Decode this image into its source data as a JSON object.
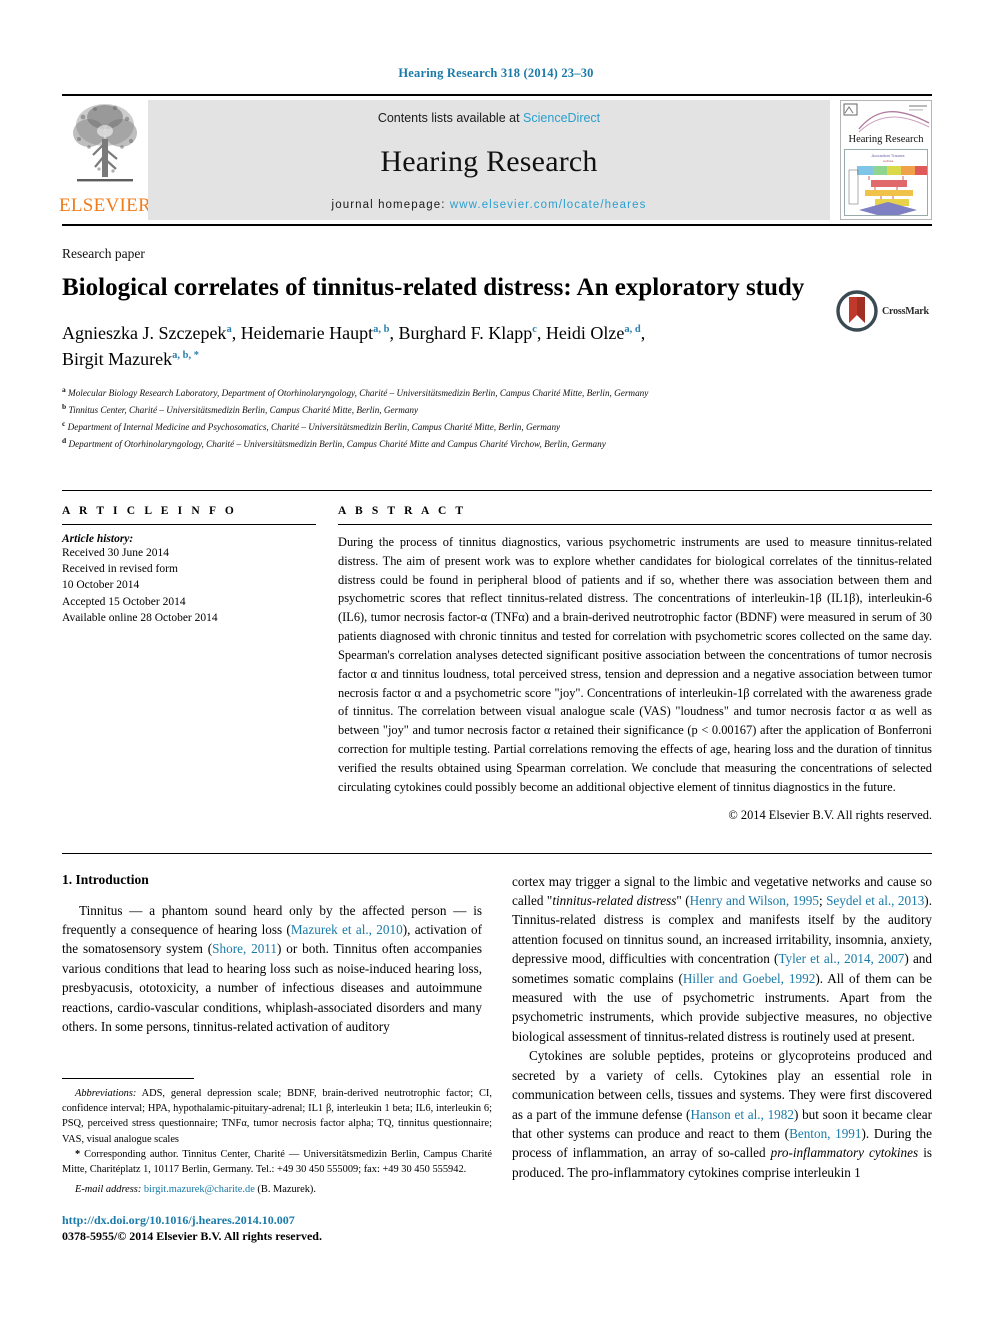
{
  "running_head": "Hearing Research 318 (2014) 23–30",
  "masthead": {
    "publisher_name": "ELSEVIER",
    "contents_prefix": "Contents lists available at",
    "contents_link": "ScienceDirect",
    "journal_title": "Hearing Research",
    "homepage_prefix": "journal homepage:",
    "homepage_link": "www.elsevier.com/locate/heares",
    "cover_title": "Hearing Research"
  },
  "article": {
    "doctype": "Research paper",
    "title": "Biological correlates of tinnitus-related distress: An exploratory study",
    "crossmark_label": "CrossMark",
    "authors_line1": "Agnieszka J. Szczepek",
    "authors": [
      {
        "name": "Agnieszka J. Szczepek",
        "marks": "a"
      },
      {
        "name": "Heidemarie Haupt",
        "marks": "a, b"
      },
      {
        "name": "Burghard F. Klapp",
        "marks": "c"
      },
      {
        "name": "Heidi Olze",
        "marks": "a, d"
      },
      {
        "name": "Birgit Mazurek",
        "marks": "a, b, *"
      }
    ],
    "affiliations": [
      {
        "mark": "a",
        "text": "Molecular Biology Research Laboratory, Department of Otorhinolaryngology, Charité – Universitätsmedizin Berlin, Campus Charité Mitte, Berlin, Germany"
      },
      {
        "mark": "b",
        "text": "Tinnitus Center, Charité – Universitätsmedizin Berlin, Campus Charité Mitte, Berlin, Germany"
      },
      {
        "mark": "c",
        "text": "Department of Internal Medicine and Psychosomatics, Charité – Universitätsmedizin Berlin, Campus Charité Mitte, Berlin, Germany"
      },
      {
        "mark": "d",
        "text": "Department of Otorhinolaryngology, Charité – Universitätsmedizin Berlin, Campus Charité Mitte and Campus Charité Virchow, Berlin, Germany"
      }
    ]
  },
  "article_info": {
    "heading": "A R T I C L E  I N F O",
    "history_label": "Article history:",
    "history": [
      "Received 30 June 2014",
      "Received in revised form",
      "10 October 2014",
      "Accepted 15 October 2014",
      "Available online 28 October 2014"
    ]
  },
  "abstract": {
    "heading": "A B S T R A C T",
    "text": "During the process of tinnitus diagnostics, various psychometric instruments are used to measure tinnitus-related distress. The aim of present work was to explore whether candidates for biological correlates of the tinnitus-related distress could be found in peripheral blood of patients and if so, whether there was association between them and psychometric scores that reflect tinnitus-related distress. The concentrations of interleukin-1β (IL1β), interleukin-6 (IL6), tumor necrosis factor-α (TNFα) and a brain-derived neutrotrophic factor (BDNF) were measured in serum of 30 patients diagnosed with chronic tinnitus and tested for correlation with psychometric scores collected on the same day. Spearman's correlation analyses detected significant positive association between the concentrations of tumor necrosis factor α and tinnitus loudness, total perceived stress, tension and depression and a negative association between tumor necrosis factor α and a psychometric score \"joy\". Concentrations of interleukin-1β correlated with the awareness grade of tinnitus. The correlation between visual analogue scale (VAS) \"loudness\" and tumor necrosis factor α as well as between \"joy\" and tumor necrosis factor α retained their significance (p < 0.00167) after the application of Bonferroni correction for multiple testing. Partial correlations removing the effects of age, hearing loss and the duration of tinnitus verified the results obtained using Spearman correlation. We conclude that measuring the concentrations of selected circulating cytokines could possibly become an additional objective element of tinnitus diagnostics in the future.",
    "copyright": "© 2014 Elsevier B.V. All rights reserved."
  },
  "introduction": {
    "heading": "1.  Introduction",
    "left_para_1_a": "Tinnitus — a phantom sound heard only by the affected person — is frequently a consequence of hearing loss (",
    "left_cite_1": "Mazurek et al., 2010",
    "left_para_1_b": "), activation of the somatosensory system (",
    "left_cite_2": "Shore, 2011",
    "left_para_1_c": ") or both. Tinnitus often accompanies various conditions that lead to hearing loss such as noise-induced hearing loss, presbyacusis, ototoxicity, a number of infectious diseases and autoimmune reactions, cardio-vascular conditions, whiplash-associated disorders and many others. In some persons, tinnitus-related activation of auditory",
    "right_para_1_a": "cortex may trigger a signal to the limbic and vegetative networks and cause so called \"",
    "right_italic_1": "tinnitus-related distress",
    "right_para_1_b": "\" (",
    "right_cite_1": "Henry and Wilson, 1995",
    "right_para_1_c": "; ",
    "right_cite_2": "Seydel et al., 2013",
    "right_para_1_d": "). Tinnitus-related distress is complex and manifests itself by the auditory attention focused on tinnitus sound, an increased irritability, insomnia, anxiety, depressive mood, difficulties with concentration (",
    "right_cite_3": "Tyler et al., 2014, 2007",
    "right_para_1_e": ") and sometimes somatic complains (",
    "right_cite_4": "Hiller and Goebel, 1992",
    "right_para_1_f": "). All of them can be measured with the use of psychometric instruments. Apart from the psychometric instruments, which provide subjective measures, no objective biological assessment of tinnitus-related distress is routinely used at present.",
    "right_para_2_a": "Cytokines are soluble peptides, proteins or glycoproteins produced and secreted by a variety of cells. Cytokines play an essential role in communication between cells, tissues and systems. They were first discovered as a part of the immune defense (",
    "right_cite_5": "Hanson et al., 1982",
    "right_para_2_b": ") but soon it became clear that other systems can produce and react to them (",
    "right_cite_6": "Benton, 1991",
    "right_para_2_c": "). During the process of inflammation, an array of so-called ",
    "right_italic_2": "pro-inflammatory cytokines",
    "right_para_2_d": " is produced. The pro-inflammatory cytokines comprise interleukin 1"
  },
  "footnotes": {
    "abbrev_label": "Abbreviations:",
    "abbrev_text": " ADS, general depression scale; BDNF, brain-derived neutrotrophic factor; CI, confidence interval; HPA, hypothalamic-pituitary-adrenal; IL1 β, interleukin 1 beta; IL6, interleukin 6; PSQ, perceived stress questionnaire; TNFα, tumor necrosis factor alpha; TQ, tinnitus questionnaire; VAS, visual analogue scales",
    "corresponding_marker": "*",
    "corresponding_text": " Corresponding author. Tinnitus Center, Charité — Universitätsmedizin Berlin, Campus Charité Mitte, Charitéplatz 1, 10117 Berlin, Germany. Tel.: +49 30 450 555009; fax: +49 30 450 555942.",
    "email_label": "E-mail address:",
    "email_link": "birgit.mazurek@charite.de",
    "email_suffix": " (B. Mazurek)."
  },
  "footer": {
    "doi": "http://dx.doi.org/10.1016/j.heares.2014.10.007",
    "issn_line": "0378-5955/© 2014 Elsevier B.V. All rights reserved."
  },
  "colors": {
    "link_blue": "#1a7aa8",
    "sd_blue": "#2a9fd0",
    "elsevier_orange": "#f07c1a",
    "masthead_grey": "#e3e3e3",
    "crossmark_red": "#c0392b"
  }
}
